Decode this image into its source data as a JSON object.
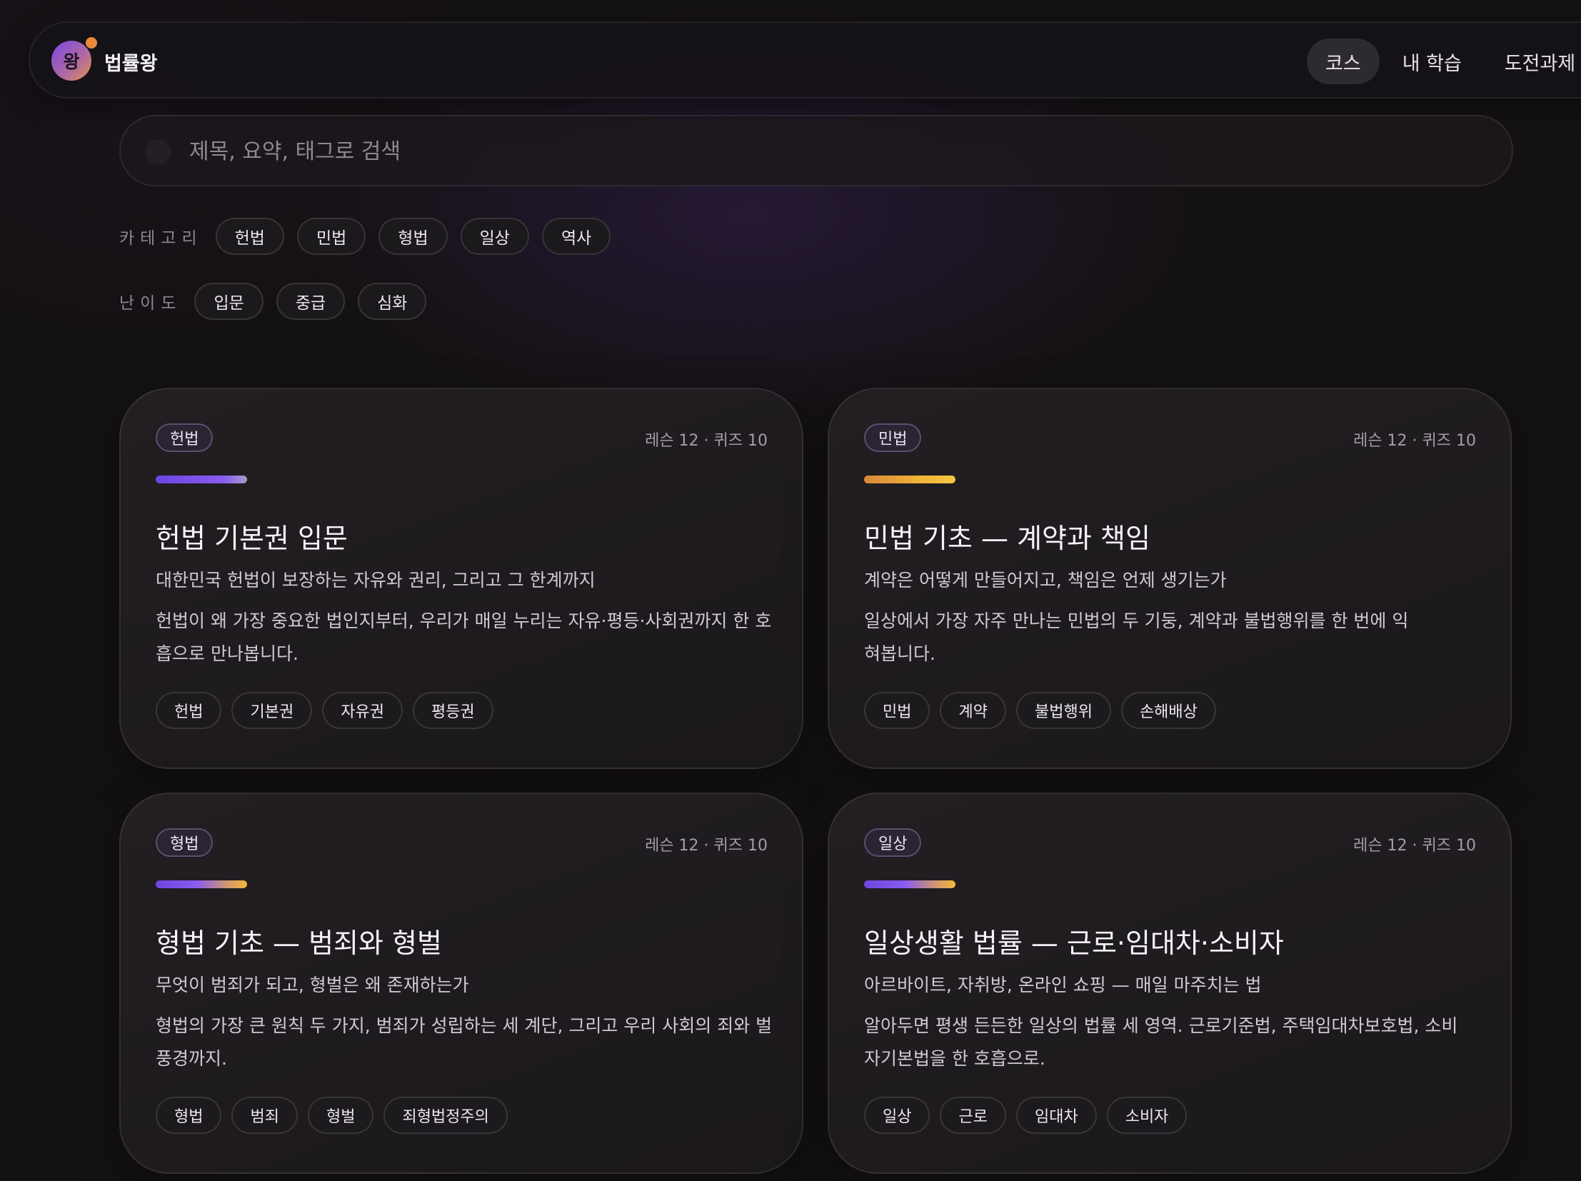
{
  "header": {
    "logo_char": "왕",
    "brand": "법률왕",
    "nav": [
      {
        "label": "코스",
        "active": true
      },
      {
        "label": "내 학습",
        "active": false
      },
      {
        "label": "도전과제",
        "active": false
      }
    ]
  },
  "search": {
    "placeholder": "제목, 요약, 태그로 검색",
    "icon": "search-icon"
  },
  "filters": {
    "category_label": "카테고리",
    "categories": [
      "헌법",
      "민법",
      "형법",
      "일상",
      "역사"
    ],
    "difficulty_label": "난이도",
    "difficulties": [
      "입문",
      "중급",
      "심화"
    ]
  },
  "courses": [
    {
      "badge": "헌법",
      "meta": "레슨 12 · 퀴즈 10",
      "bar_color": "purple",
      "title": "헌법 기본권 입문",
      "subtitle": "대한민국 헌법이 보장하는 자유와 권리, 그리고 그 한계까지",
      "description": "헌법이 왜 가장 중요한 법인지부터, 우리가 매일 누리는 자유·평등·사회권까지 한 호흡으로 만나봅니다.",
      "tags": [
        "헌법",
        "기본권",
        "자유권",
        "평등권"
      ]
    },
    {
      "badge": "민법",
      "meta": "레슨 12 · 퀴즈 10",
      "bar_color": "orange",
      "title": "민법 기초 — 계약과 책임",
      "subtitle": "계약은 어떻게 만들어지고, 책임은 언제 생기는가",
      "description": "일상에서 가장 자주 만나는 민법의 두 기둥, 계약과 불법행위를 한 번에 익혀봅니다.",
      "tags": [
        "민법",
        "계약",
        "불법행위",
        "손해배상"
      ]
    },
    {
      "badge": "형법",
      "meta": "레슨 12 · 퀴즈 10",
      "bar_color": "mix",
      "title": "형법 기초 — 범죄와 형벌",
      "subtitle": "무엇이 범죄가 되고, 형벌은 왜 존재하는가",
      "description": "형법의 가장 큰 원칙 두 가지, 범죄가 성립하는 세 계단, 그리고 우리 사회의 죄와 벌 풍경까지.",
      "tags": [
        "형법",
        "범죄",
        "형벌",
        "죄형법정주의"
      ]
    },
    {
      "badge": "일상",
      "meta": "레슨 12 · 퀴즈 10",
      "bar_color": "mix",
      "title": "일상생활 법률 — 근로·임대차·소비자",
      "subtitle": "아르바이트, 자취방, 온라인 쇼핑 — 매일 마주치는 법",
      "description": "알아두면 평생 든든한 일상의 법률 세 영역. 근로기준법, 주택임대차보호법, 소비자기본법을 한 호흡으로.",
      "tags": [
        "일상",
        "근로",
        "임대차",
        "소비자"
      ]
    }
  ]
}
